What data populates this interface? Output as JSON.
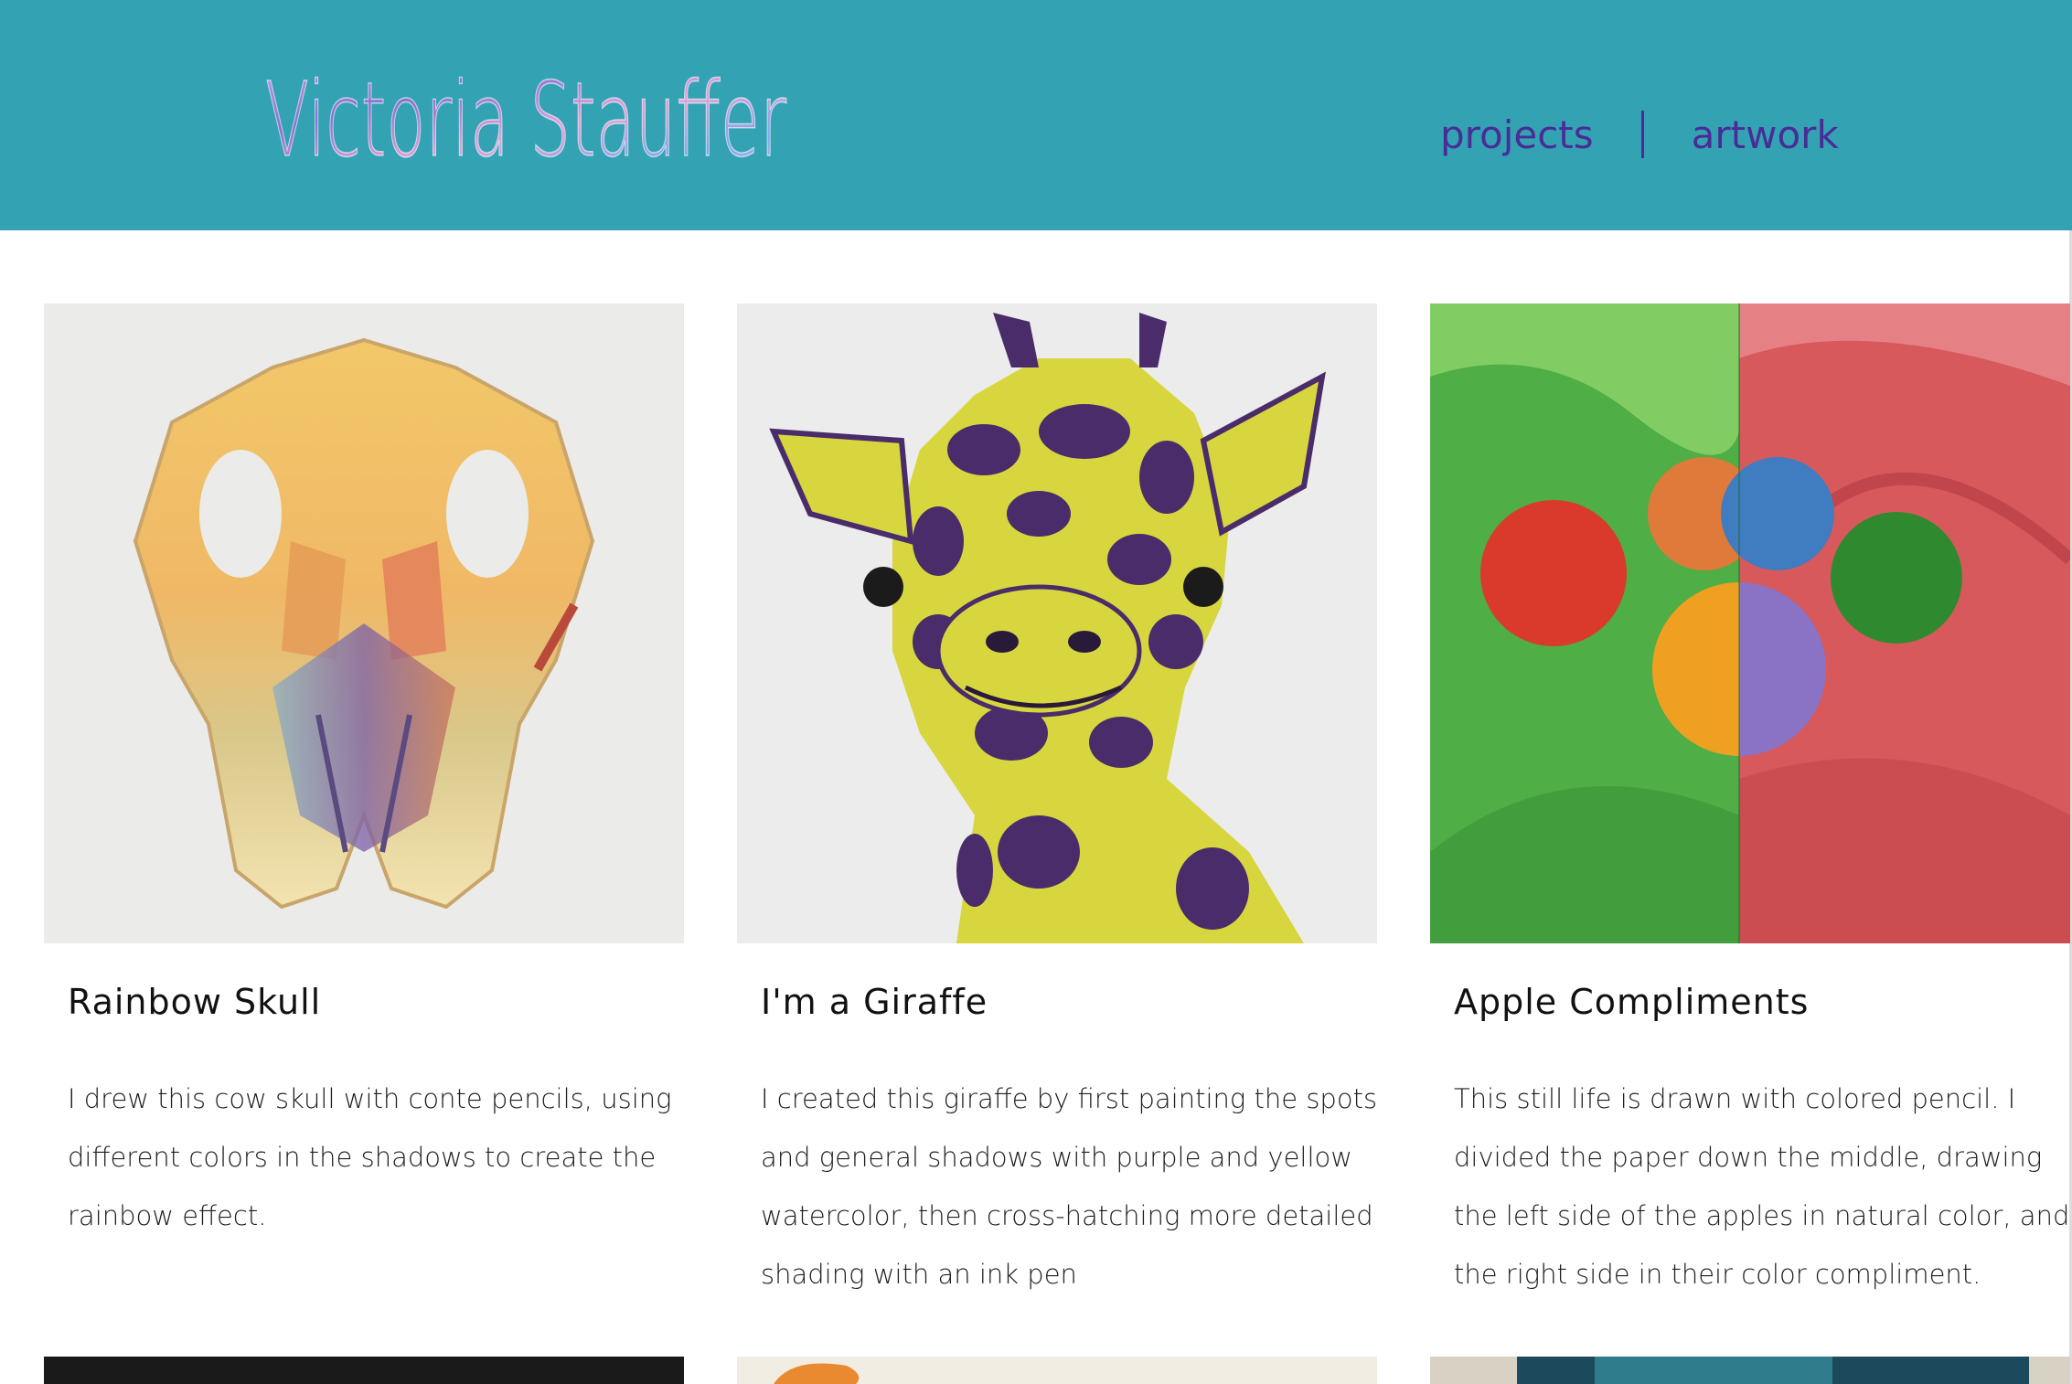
{
  "header": {
    "site_title": "Victoria Stauffer",
    "nav": [
      "projects",
      "artwork"
    ],
    "colors": {
      "background": "#33a3b4",
      "nav_text": "#4a2c96"
    }
  },
  "gallery": {
    "items": [
      {
        "title": "Rainbow Skull",
        "description": "I drew this cow skull with conte pencils, using different colors in the shadows to create the rainbow effect.",
        "image_icon": "skull-drawing"
      },
      {
        "title": "I'm a Giraffe",
        "description": "I created this giraffe by first painting the spots and general shadows with purple and yellow watercolor, then cross-hatching more detailed shading with an ink pen",
        "image_icon": "giraffe-painting"
      },
      {
        "title": "Apple Compliments",
        "description": "This still life is drawn with colored pencil. I divided the paper down the middle, drawing the left side of the apples in natural color, and the right side in their color compliment.",
        "image_icon": "apples-still-life"
      }
    ]
  }
}
